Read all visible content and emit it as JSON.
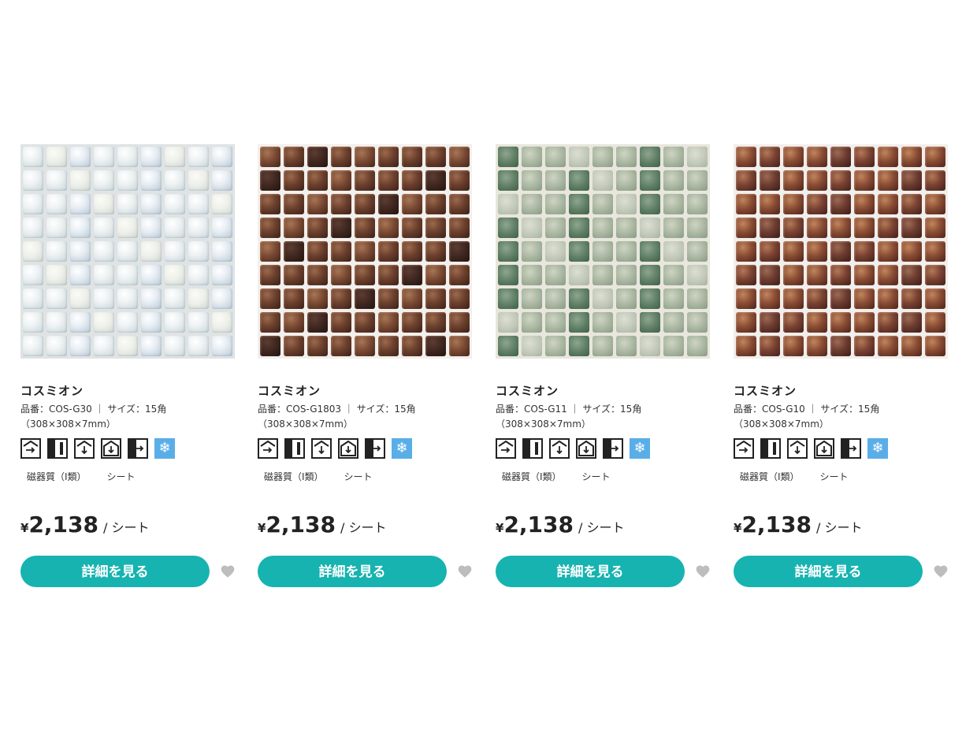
{
  "products": [
    {
      "name": "コスミオン",
      "spec": "品番：COS-G30 ｜ サイズ：15角",
      "dims": "（308×308×7mm）",
      "material": "磁器質（Ⅰ類）",
      "form": "シート",
      "currency": "¥",
      "price": "2,138",
      "unit": "/ シート",
      "button_label": "詳細を見る",
      "swatch": "white-pearl"
    },
    {
      "name": "コスミオン",
      "spec": "品番：COS-G1803 ｜ サイズ：15角",
      "dims": "（308×308×7mm）",
      "material": "磁器質（Ⅰ類）",
      "form": "シート",
      "currency": "¥",
      "price": "2,138",
      "unit": "/ シート",
      "button_label": "詳細を見る",
      "swatch": "brown-copper"
    },
    {
      "name": "コスミオン",
      "spec": "品番：COS-G11 ｜ サイズ：15角",
      "dims": "（308×308×7mm）",
      "material": "磁器質（Ⅰ類）",
      "form": "シート",
      "currency": "¥",
      "price": "2,138",
      "unit": "/ シート",
      "button_label": "詳細を見る",
      "swatch": "green-marble"
    },
    {
      "name": "コスミオン",
      "spec": "品番：COS-G10 ｜ サイズ：15角",
      "dims": "（308×308×7mm）",
      "material": "磁器質（Ⅰ類）",
      "form": "シート",
      "currency": "¥",
      "price": "2,138",
      "unit": "/ シート",
      "button_label": "詳細を見る",
      "swatch": "red-brown-copper"
    }
  ],
  "usage_icons": [
    "exterior-wall-icon",
    "interior-wall-icon",
    "exterior-floor-icon",
    "interior-floor-icon",
    "wet-area-icon",
    "frost-resistant-icon"
  ],
  "colors": {
    "button": "#16b3b0",
    "heart": "#bdbdbd",
    "frost_icon": "#5aaee8"
  }
}
